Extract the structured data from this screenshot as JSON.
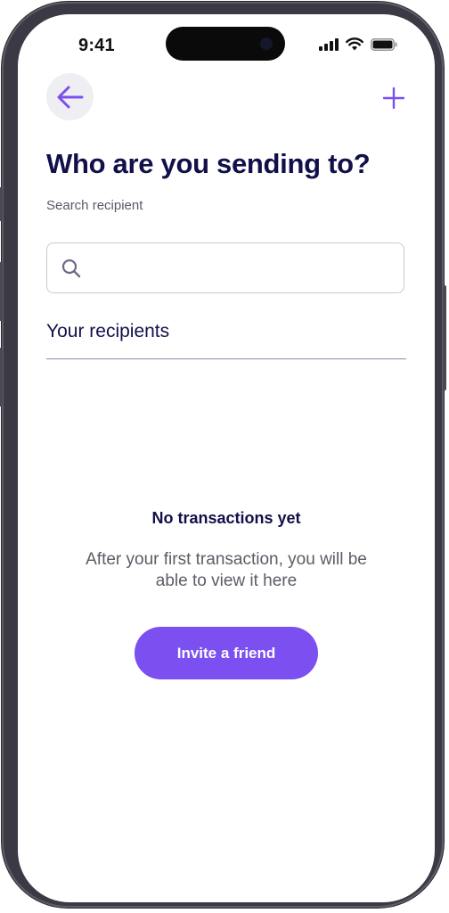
{
  "status_bar": {
    "time": "9:41",
    "icons": [
      "cellular-signal-icon",
      "wifi-icon",
      "battery-icon"
    ]
  },
  "header": {
    "back_icon": "arrow-left-icon",
    "add_icon": "plus-icon"
  },
  "page": {
    "title": "Who are you sending to?",
    "subtitle": "Search recipient"
  },
  "search": {
    "icon": "search-icon",
    "value": "",
    "placeholder": ""
  },
  "recipients": {
    "section_title": "Your recipients"
  },
  "empty_state": {
    "title": "No transactions yet",
    "description": "After your first transaction, you will be able to view it here"
  },
  "actions": {
    "invite_label": "Invite a friend"
  },
  "colors": {
    "accent": "#7b4ff0",
    "heading": "#12104a",
    "muted_text": "#5c5c66"
  }
}
